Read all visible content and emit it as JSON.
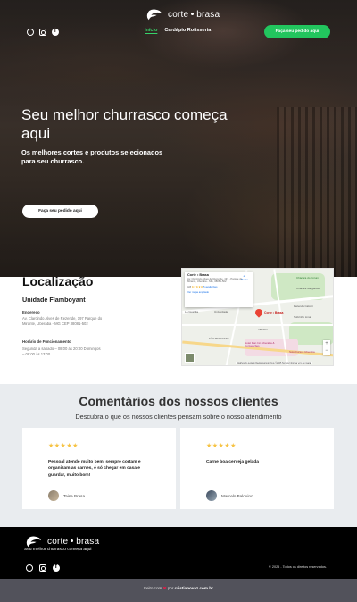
{
  "brand": {
    "name_left": "corte",
    "name_right": "brasa"
  },
  "nav": {
    "items": [
      "Início",
      "Cardápio Rotisseria"
    ],
    "cta": "Faça seu pedido aqui"
  },
  "socials": [
    "whatsapp-icon",
    "instagram-icon",
    "facebook-icon"
  ],
  "hero": {
    "title": "Seu melhor churrasco começa aqui",
    "subtitle": "Os melhores cortes e produtos selecionados para seu churrasco.",
    "cta": "Faça seu pedido aqui"
  },
  "location": {
    "title": "Localização",
    "unit": "Unidade Flamboyant",
    "address_label": "Endereço",
    "address": "Av. Clarcindo Alves de Rezende, 197 Parque do Mirante, Uberaba - MG CEP 38081-502",
    "hours_label": "Horário de Funcionamento",
    "hours": "Segunda a sábado – 08:00 às 20:00 Domingos – 08:00 às 13:00"
  },
  "map": {
    "place": "Corte • Brasa",
    "address": "Av. Clarcindo Alves de Rezende, 197 - Parque do Mirante, Uberaba - MG, 38081-502",
    "directions": "Rotas",
    "link": "Ver mapa ampliado",
    "rating": "4,8",
    "stars": "★★★★★",
    "reviews": "5 avaliações",
    "pin_label": "Corte • Brasa",
    "labels": [
      "LA Guardia",
      "Univerdade",
      "ABADIA",
      "SÃO BENEDITO",
      "Chácara do Fórum",
      "Chácara Margarida",
      "Fazenda Calcari",
      "Hotel Dan Inn Uberaba & Convenções",
      "Sobrinho Lima",
      "Solo Cursos Uberaba"
    ],
    "footer": "Atalhos do teclado  Dados cartográficos ©2025  Termos  Informar erro no mapa"
  },
  "reviews": {
    "title": "Comentários dos nossos clientes",
    "subtitle": "Descubra o que os nossos clientes pensam sobre o nosso atendimento",
    "items": [
      {
        "stars": "★★★★★",
        "text": "Pessoal atende muito bem, sempre cortam e organizam as carnes, é só chegar em casa e guardar, muito bom!",
        "author": "Taisa Brasa"
      },
      {
        "stars": "★★★★★",
        "text": "Carne boa cerveja gelada",
        "author": "Marcelo Balduino"
      }
    ]
  },
  "footer": {
    "tagline": "Seu melhor churrasco começa aqui",
    "copyright": "© 2025 - Todos os direitos reservados.",
    "made_prefix": "Feito com",
    "made_mid": "por",
    "made_link": "cristianovaz.com.br"
  }
}
